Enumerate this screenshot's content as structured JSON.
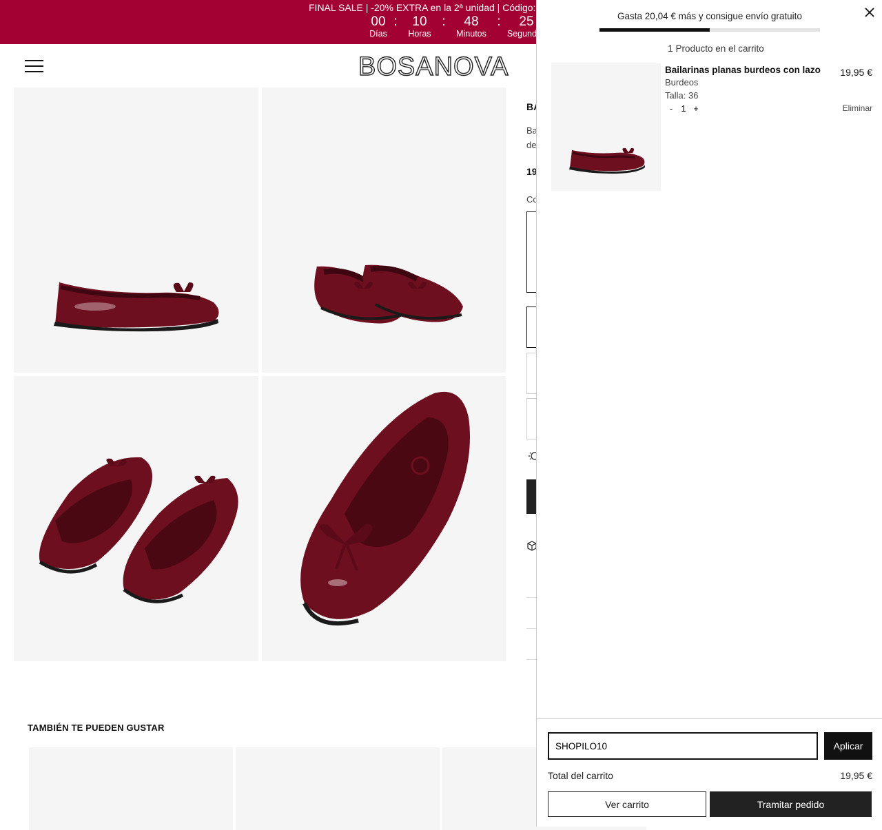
{
  "promo": {
    "text": "FINAL SALE | -20% EXTRA en la 2ª unidad | Código:",
    "countdown": [
      {
        "value": "00",
        "label": "Días"
      },
      {
        "value": "10",
        "label": "Horas"
      },
      {
        "value": "48",
        "label": "Minutos"
      },
      {
        "value": "25",
        "label": "Segundos"
      }
    ],
    "separator": ":",
    "background": "#a30034"
  },
  "header": {
    "logo": "BOSANOVA"
  },
  "product": {
    "title_partial": "BA",
    "desc_line1_partial": "Ba",
    "desc_line2_partial": "de",
    "price_partial": "19",
    "color_label_partial": "Co"
  },
  "related": {
    "title": "TAMBIÉN TE PUEDEN GUSTAR"
  },
  "cart": {
    "shipping_message": "Gasta 20,04 € más y consigue envío gratuito",
    "shipping_progress_percent": 50,
    "count_message": "1 Producto en el carrito",
    "items": [
      {
        "name": "Bailarinas planas burdeos con lazo",
        "price": "19,95 €",
        "color": "Burdeos",
        "size": "Talla: 36",
        "qty": "1",
        "minus": "-",
        "plus": "+",
        "remove": "Eliminar"
      }
    ],
    "coupon_value": "SHOPILO10",
    "apply_label": "Aplicar",
    "total_label": "Total del carrito",
    "total_value": "19,95 €",
    "view_cart_label": "Ver carrito",
    "checkout_label": "Tramitar pedido"
  },
  "colors": {
    "shoe": "#6e0f1f",
    "shoe_dark": "#4a0813",
    "sole": "#1a1a1a"
  }
}
